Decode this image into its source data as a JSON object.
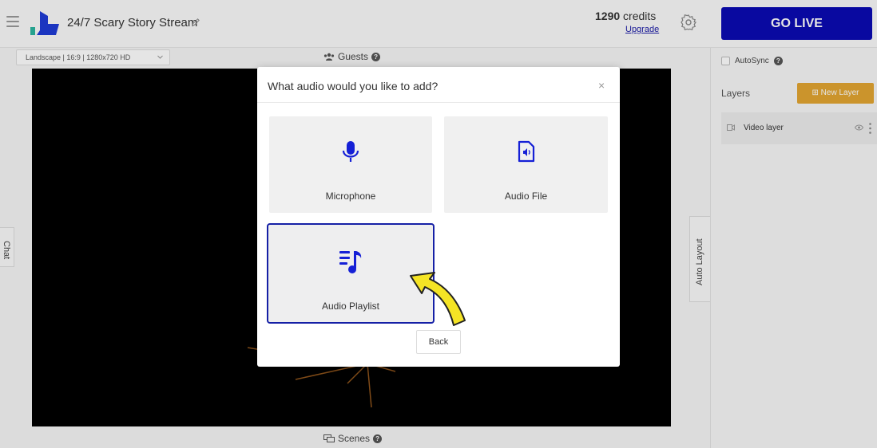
{
  "header": {
    "title": "24/7 Scary Story Stream",
    "credits_value": "1290",
    "credits_label": "credits",
    "upgrade_label": "Upgrade",
    "go_live_label": "GO LIVE"
  },
  "canvas": {
    "layout_select": "Landscape | 16:9 | 1280x720 HD",
    "guests_label": "Guests",
    "scenes_label": "Scenes",
    "chat_label": "Chat",
    "auto_layout_label": "Auto Layout"
  },
  "right_panel": {
    "autosync_label": "AutoSync",
    "layers_title": "Layers",
    "new_layer_label": "New Layer",
    "layers": [
      {
        "name": "Video layer"
      }
    ]
  },
  "modal": {
    "title": "What audio would you like to add?",
    "close_glyph": "×",
    "options": [
      {
        "label": "Microphone",
        "icon": "microphone-icon"
      },
      {
        "label": "Audio File",
        "icon": "audio-file-icon"
      },
      {
        "label": "Audio Playlist",
        "icon": "playlist-icon"
      }
    ],
    "back_label": "Back"
  },
  "colors": {
    "accent": "#0b0bb3",
    "new_layer": "#e2a531",
    "arrow": "#f5e425"
  }
}
